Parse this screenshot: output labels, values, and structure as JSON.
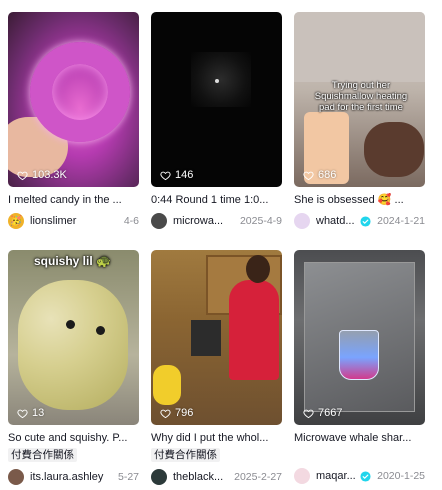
{
  "videos": [
    {
      "likes": "103.3K",
      "description": "I melted candy in the ...",
      "tag": "",
      "author": "lionslimer",
      "verified": false,
      "date": "4-6",
      "avatar_icon": "slime-avatar-icon"
    },
    {
      "likes": "146",
      "description": "0:44 Round 1 time 1:0...",
      "tag": "",
      "author": "microwa...",
      "verified": false,
      "date": "2025-4-9",
      "avatar_icon": "user-avatar-icon"
    },
    {
      "likes": "686",
      "description": "She is obsessed 🥰 ...",
      "tag": "",
      "author": "whatd...",
      "verified": true,
      "date": "2024-1-21",
      "avatar_icon": "user-avatar-icon",
      "overlay_caption": "Trying out her Squishmallow heating pad for the first time"
    },
    {
      "likes": "13",
      "description": "So cute and squishy. P...",
      "tag": "付費合作關係",
      "author": "its.laura.ashley",
      "verified": false,
      "date": "5-27",
      "avatar_icon": "user-avatar-icon",
      "overlay_caption": "squishy lil 🐢"
    },
    {
      "likes": "796",
      "description": "Why did I put the whol...",
      "tag": "付費合作關係",
      "author": "theblack...",
      "verified": false,
      "date": "2025-2-27",
      "avatar_icon": "user-avatar-icon"
    },
    {
      "likes": "7667",
      "description": "Microwave whale shar...",
      "tag": "",
      "author": "maqar...",
      "verified": true,
      "date": "2020-1-25",
      "avatar_icon": "user-avatar-icon"
    }
  ]
}
